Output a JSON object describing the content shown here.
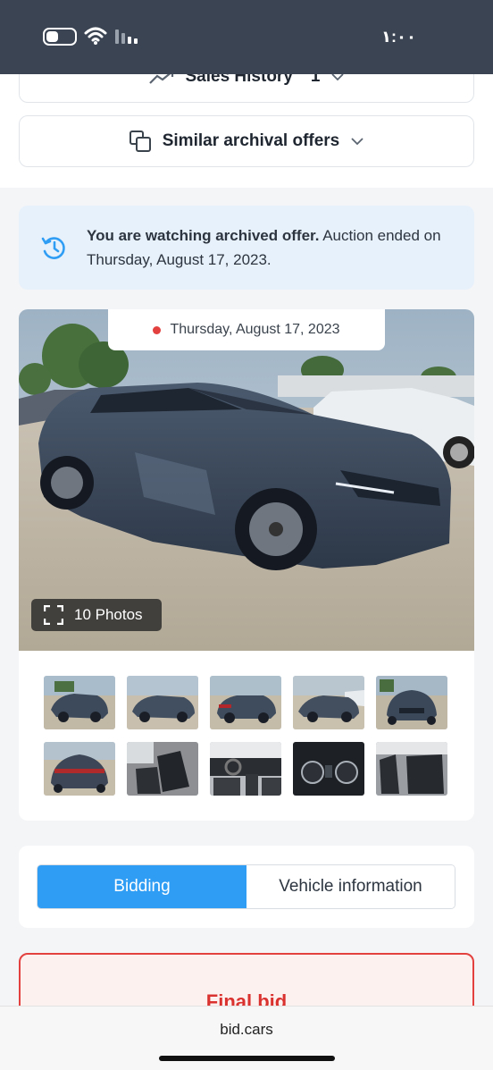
{
  "status_bar": {
    "time": "١:٠٠"
  },
  "sections": {
    "sales_history": {
      "label": "Sales History",
      "count": "1"
    },
    "similar_offers": {
      "label": "Similar archival offers"
    }
  },
  "notice": {
    "bold": "You are watching archived offer.",
    "rest": " Auction ended on Thursday, August 17, 2023."
  },
  "gallery": {
    "date": "Thursday, August 17, 2023",
    "photos_button": "10 Photos",
    "thumbnail_count": 10
  },
  "tabs": {
    "active": "Bidding",
    "inactive": "Vehicle information"
  },
  "final_bid": {
    "label": "Final bid"
  },
  "browser": {
    "url": "bid.cars"
  },
  "colors": {
    "accent": "#2f9df4",
    "danger": "#e2413f",
    "status_bar": "#3a4452"
  }
}
